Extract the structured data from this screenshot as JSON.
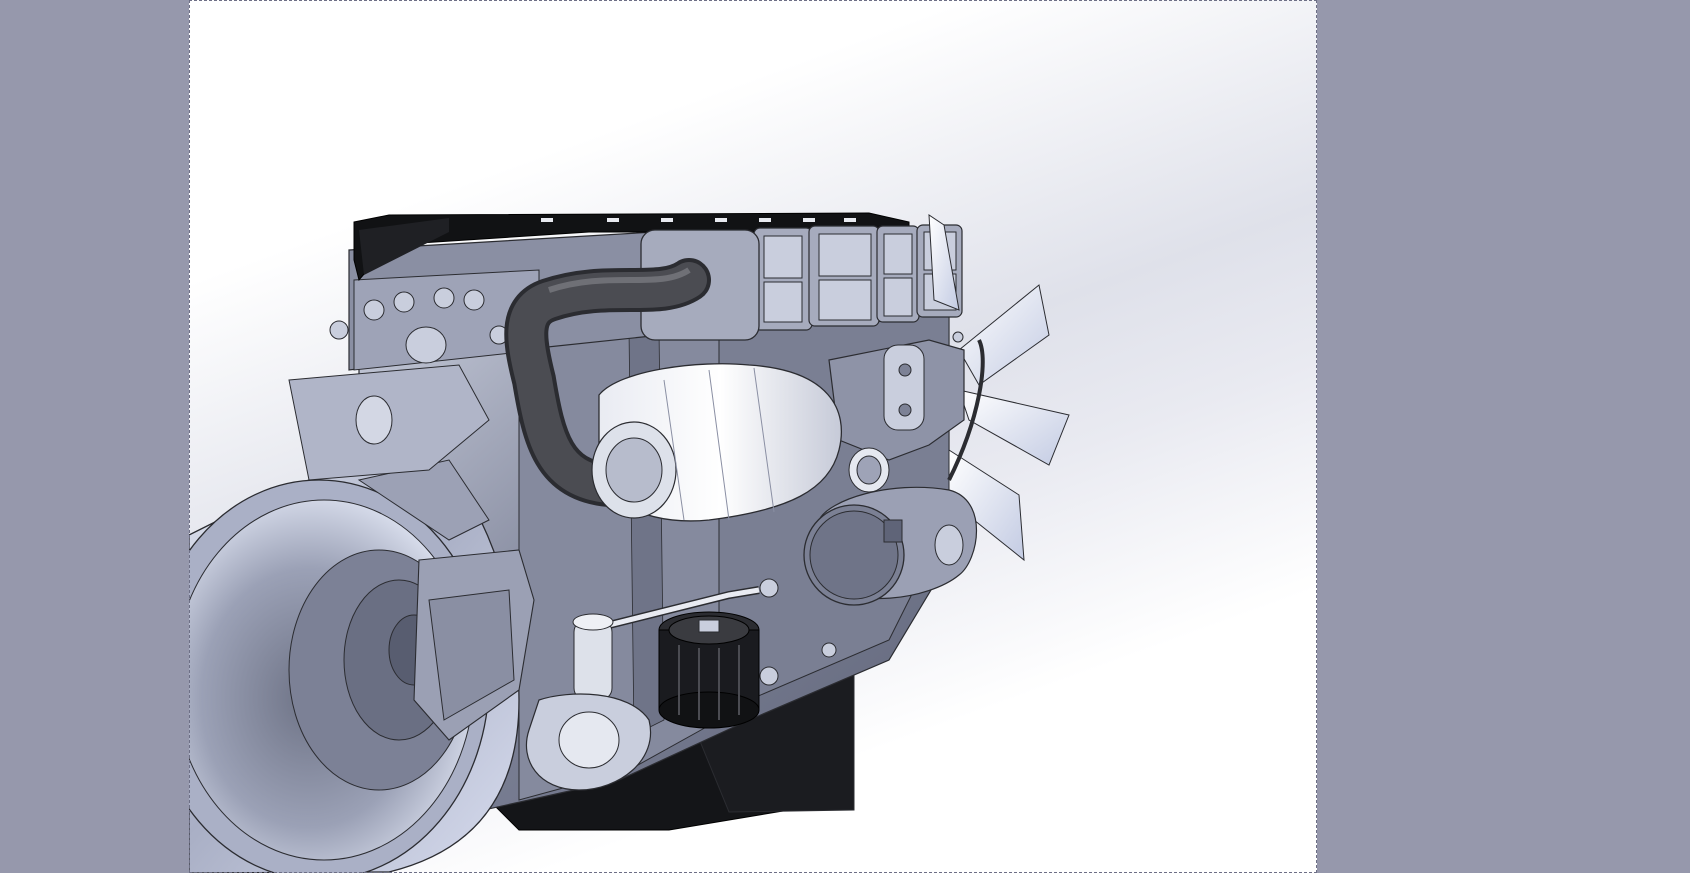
{
  "viewport": {
    "model": "diesel-engine-assembly",
    "background_colors": {
      "outer": "#9698ac",
      "sheet": "#ffffff",
      "shade": "#dfe1ea"
    },
    "part_colors": {
      "metal": "#7d8296",
      "metal_light": "#c9cedd",
      "dark": "#2b2c31",
      "black": "#111214",
      "pipe": "#3a3b40"
    }
  }
}
